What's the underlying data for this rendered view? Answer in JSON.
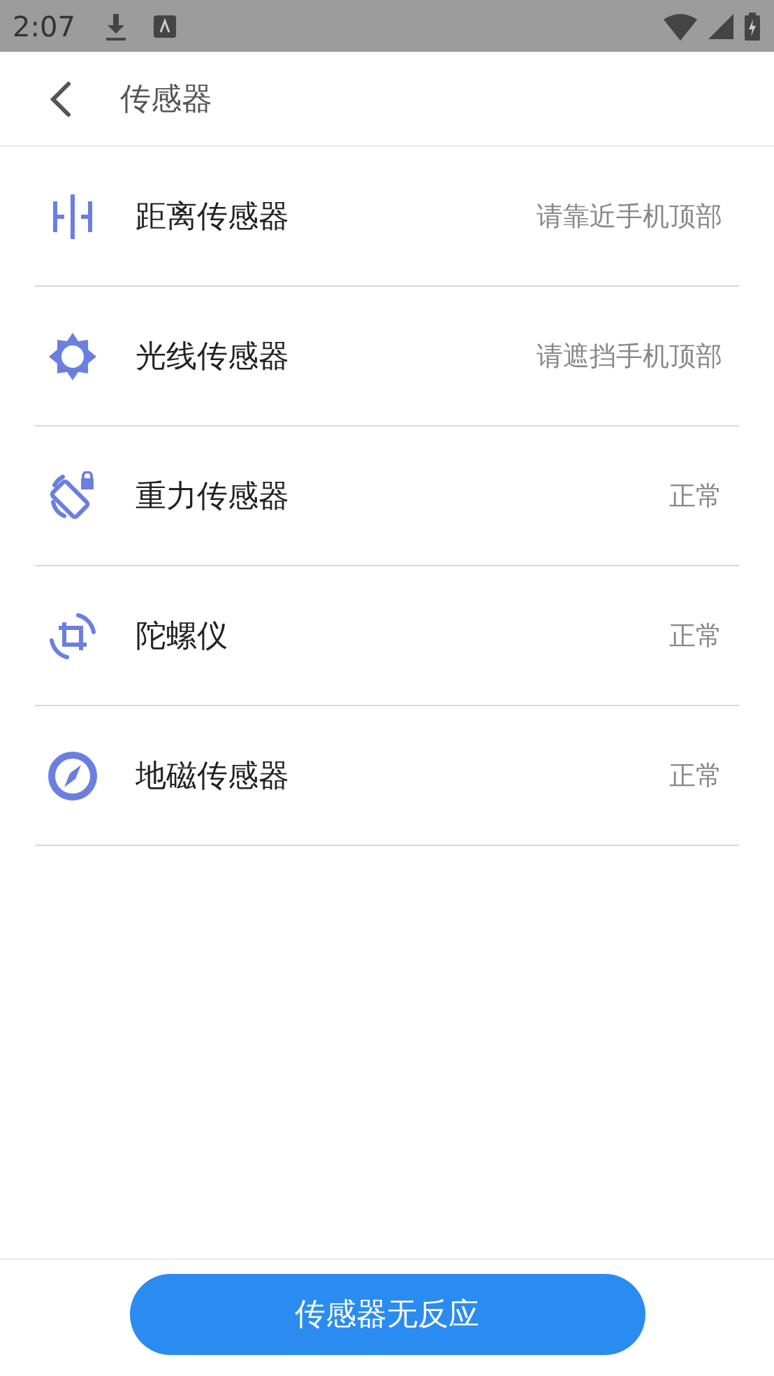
{
  "status_bar": {
    "time": "2:07"
  },
  "header": {
    "title": "传感器"
  },
  "sensors": [
    {
      "kind": "proximity",
      "name": "距离传感器",
      "status": "请靠近手机顶部"
    },
    {
      "kind": "light",
      "name": "光线传感器",
      "status": "请遮挡手机顶部"
    },
    {
      "kind": "gravity",
      "name": "重力传感器",
      "status": "正常"
    },
    {
      "kind": "gyroscope",
      "name": "陀螺仪",
      "status": "正常"
    },
    {
      "kind": "magnetic",
      "name": "地磁传感器",
      "status": "正常"
    }
  ],
  "button": {
    "label": "传感器无反应"
  }
}
